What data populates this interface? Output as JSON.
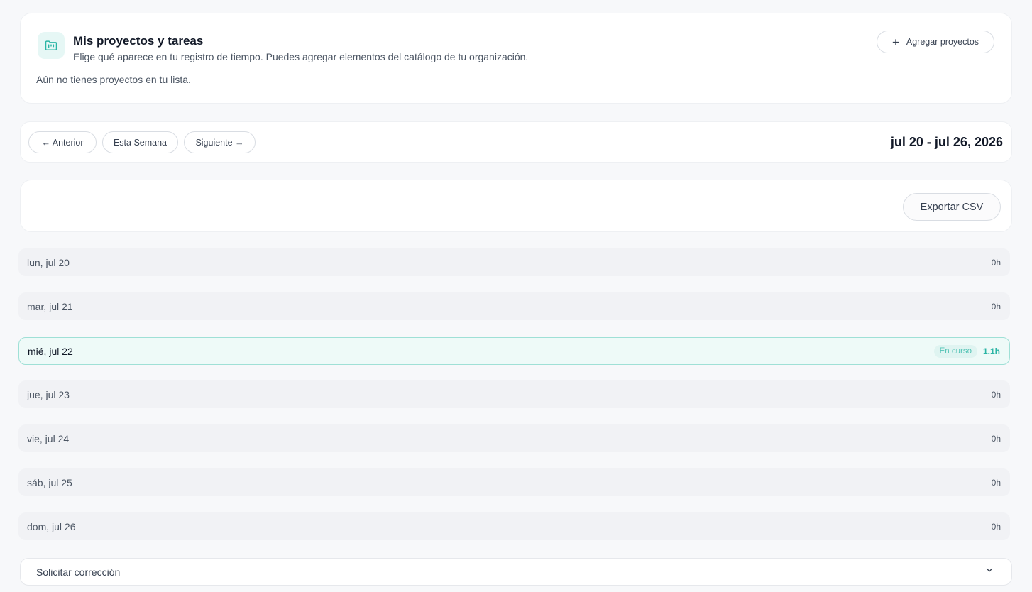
{
  "projects": {
    "title": "Mis proyectos y tareas",
    "subtitle": "Elige qué aparece en tu registro de tiempo. Puedes agregar elementos del catálogo de tu organización.",
    "empty_message": "Aún no tienes proyectos en tu lista.",
    "add_button_label": "Agregar proyectos",
    "icon": "folder-kanban-icon"
  },
  "nav": {
    "prev_label": "← Anterior",
    "this_week_label": "Esta Semana",
    "next_label": "Siguiente →",
    "range": "jul 20 - jul 26, 2026"
  },
  "export": {
    "label": "Exportar CSV"
  },
  "days": [
    {
      "label": "lun, jul 20",
      "hours": "0h"
    },
    {
      "label": "mar, jul 21",
      "hours": "0h"
    },
    {
      "label": "mié, jul 22",
      "hours": "1.1h",
      "badge": "En curso"
    },
    {
      "label": "jue, jul 23",
      "hours": "0h"
    },
    {
      "label": "vie, jul 24",
      "hours": "0h"
    },
    {
      "label": "sáb, jul 25",
      "hours": "0h"
    },
    {
      "label": "dom, jul 26",
      "hours": "0h"
    }
  ],
  "correction": {
    "label": "Solicitar corrección"
  },
  "colors": {
    "accent": "#2bb5a5",
    "accent_bg": "#eefaf8",
    "page_bg": "#f7f8fa"
  }
}
